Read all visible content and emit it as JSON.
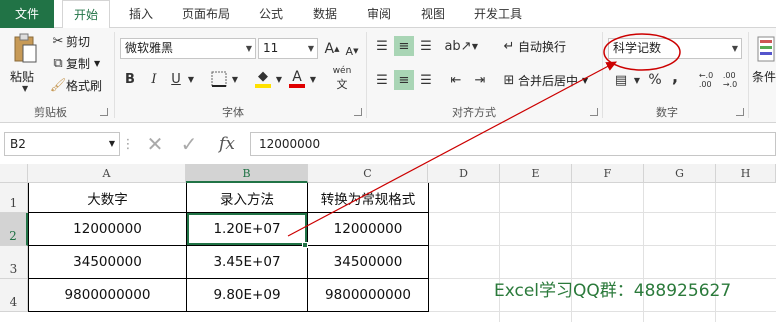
{
  "tabs": [
    "文件",
    "开始",
    "插入",
    "页面布局",
    "公式",
    "数据",
    "审阅",
    "视图",
    "开发工具"
  ],
  "clipboard": {
    "paste": "粘贴",
    "cut": "剪切",
    "copy": "复制",
    "format_painter": "格式刷",
    "group": "剪贴板"
  },
  "font": {
    "name": "微软雅黑",
    "size": "11",
    "group": "字体",
    "bold": "B",
    "italic": "I",
    "underline": "U",
    "phonetic": "wén",
    "grow": "A",
    "shrink": "A"
  },
  "alignment": {
    "wrap": "自动换行",
    "merge": "合并后居中",
    "group": "对齐方式"
  },
  "number": {
    "format": "科学记数",
    "group": "数字",
    "percent": "%",
    "comma": ",",
    "inc_dec": "←.0 .00",
    "dec_dec": ".00 →.0"
  },
  "styles": {
    "conditional": "条件"
  },
  "formula_bar": {
    "name_box": "B2",
    "fx": "fx",
    "value": "12000000"
  },
  "columns": [
    "A",
    "B",
    "C",
    "D",
    "E",
    "F",
    "G",
    "H"
  ],
  "rows": [
    "1",
    "2",
    "3",
    "4"
  ],
  "table": {
    "headers": [
      "大数字",
      "录入方法",
      "转换为常规格式"
    ],
    "rows": [
      [
        "12000000",
        "1.20E+07",
        "12000000"
      ],
      [
        "34500000",
        "3.45E+07",
        "34500000"
      ],
      [
        "9800000000",
        "9.80E+09",
        "9800000000"
      ]
    ]
  },
  "watermark": "Excel学习QQ群：488925627",
  "colors": {
    "accent": "#217346",
    "arrow": "#cc0000",
    "font_color": "#e00000",
    "fill_color": "#ffe100"
  }
}
